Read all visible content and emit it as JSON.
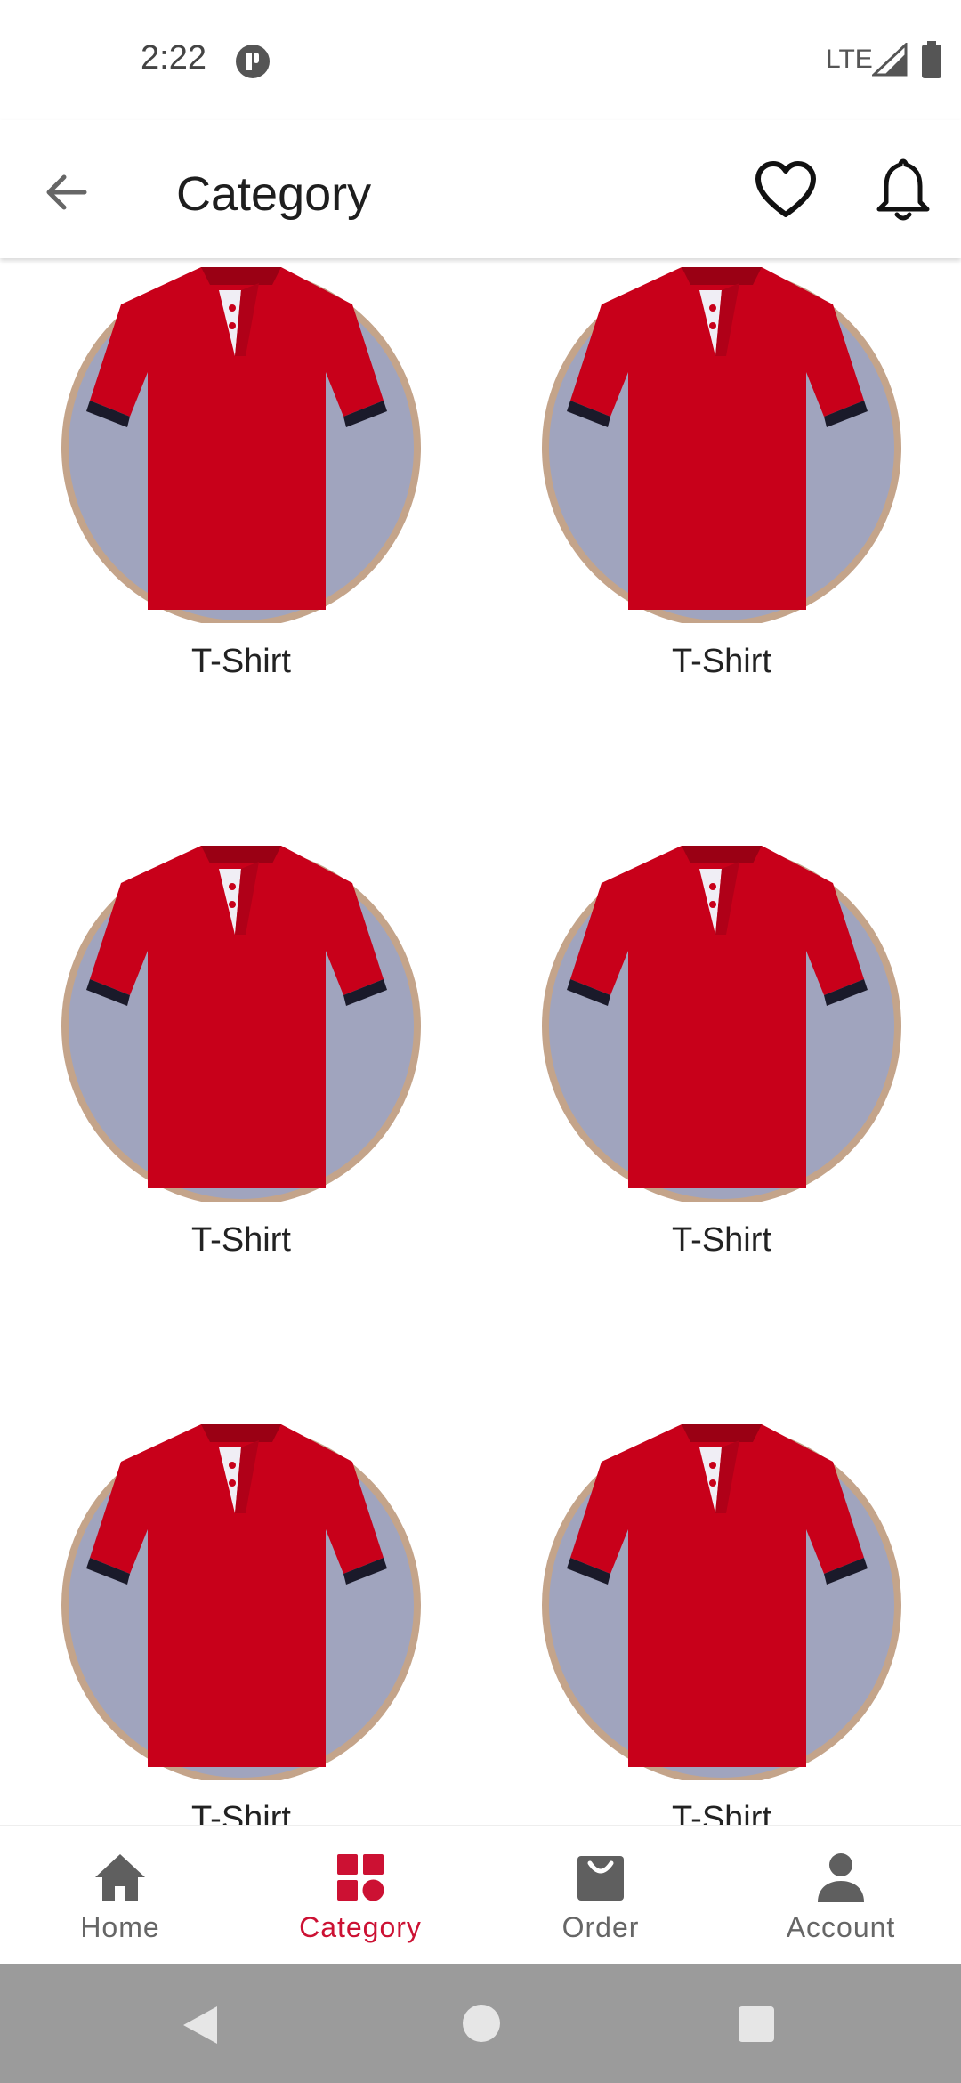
{
  "status_bar": {
    "time": "2:22",
    "network": "LTE"
  },
  "app_bar": {
    "title": "Category"
  },
  "categories": [
    {
      "label": "T-Shirt"
    },
    {
      "label": "T-Shirt"
    },
    {
      "label": "T-Shirt"
    },
    {
      "label": "T-Shirt"
    },
    {
      "label": "T-Shirt"
    },
    {
      "label": "T-Shirt"
    }
  ],
  "bottom_nav": {
    "items": [
      {
        "label": "Home",
        "icon": "home-icon"
      },
      {
        "label": "Category",
        "icon": "category-icon",
        "active": true
      },
      {
        "label": "Order",
        "icon": "shopping-bag-icon"
      },
      {
        "label": "Account",
        "icon": "person-icon"
      }
    ]
  },
  "colors": {
    "accent": "#cc1133",
    "shirt": "#c8001a",
    "circle_fill": "#a0a4be",
    "circle_border": "#c4a48a"
  }
}
